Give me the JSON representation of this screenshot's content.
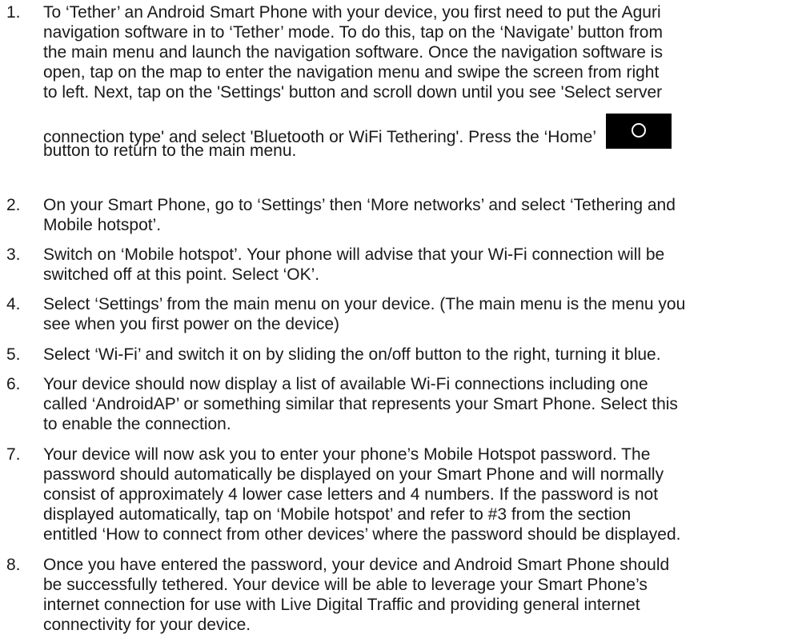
{
  "steps": [
    {
      "number": "1.",
      "lines": [
        "To ‘Tether’ an Android Smart Phone with your device, you first need to put the Aguri",
        "navigation software in to ‘Tether’ mode. To do this, tap on the ‘Navigate’ button from",
        "the main menu and launch the navigation software. Once the navigation software is",
        "open, tap on the map to enter the navigation menu and swipe the screen from right",
        "to left. Next, tap on the 'Settings' button and scroll down until you see 'Select server",
        "connection type' and select 'Bluetooth or WiFi Tethering'. Press the ‘Home’",
        "button to return to the main menu."
      ],
      "icon": "home-button-icon"
    },
    {
      "number": "2.",
      "lines": [
        "On your Smart Phone, go to ‘Settings’ then ‘More networks’ and select ‘Tethering and",
        "Mobile hotspot’."
      ]
    },
    {
      "number": "3.",
      "lines": [
        "Switch on ‘Mobile hotspot’. Your phone will advise that your Wi-Fi connection will be",
        "switched off at this point. Select ‘OK’."
      ]
    },
    {
      "number": "4.",
      "lines": [
        "Select ‘Settings’ from the main menu on your device. (The main menu is the menu you",
        "see when you first power on the device)"
      ]
    },
    {
      "number": "5.",
      "lines": [
        "Select ‘Wi-Fi’ and switch it on by sliding the on/off button to the right, turning it blue."
      ]
    },
    {
      "number": "6.",
      "lines": [
        "Your device should now display a list of available Wi-Fi connections including one",
        "called ‘AndroidAP’ or something similar that represents your Smart Phone. Select this",
        "to enable the connection."
      ]
    },
    {
      "number": "7.",
      "lines": [
        "Your device will now ask you to enter your phone’s Mobile Hotspot password. The",
        "password should automatically be displayed on your Smart Phone and will normally",
        "consist of approximately 4 lower case letters and 4 numbers. If the password is not",
        "displayed automatically, tap on ‘Mobile hotspot’ and refer to #3 from the section",
        "entitled ‘How to connect from other devices’ where the password should be displayed."
      ]
    },
    {
      "number": "8.",
      "lines": [
        "Once you have entered the password, your device and Android Smart Phone should",
        "be successfully tethered. Your device will be able to leverage your Smart Phone’s",
        "internet connection for use with Live Digital Traffic and providing general internet",
        "connectivity for your device."
      ]
    }
  ]
}
